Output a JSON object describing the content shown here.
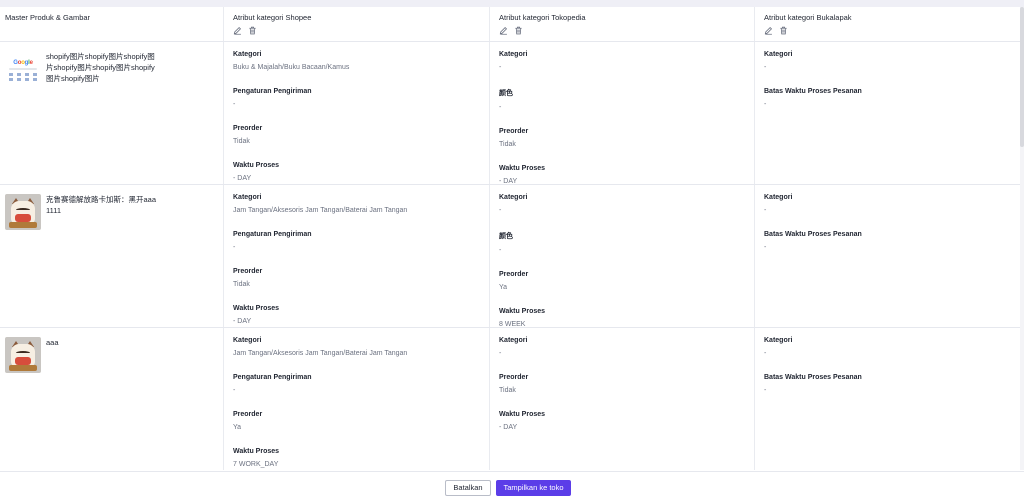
{
  "header": {
    "col0": "Master Produk & Gambar",
    "col1": "Atribut kategori Shopee",
    "col2": "Atribut kategori Tokopedia",
    "col3": "Atribut kategori Bukalapak"
  },
  "rows": [
    {
      "product": {
        "name": "shopify图片shopify图片shopify图片shopify图片shopify图片shopify图片shopify图片"
      },
      "shopee": [
        {
          "k": "Kategori",
          "v": "Buku & Majalah/Buku Bacaan/Kamus"
        },
        {
          "k": "Pengaturan Pengiriman",
          "v": "-"
        },
        {
          "k": "Preorder",
          "v": "Tidak"
        },
        {
          "k": "Waktu Proses",
          "v": "- DAY"
        }
      ],
      "tokopedia": [
        {
          "k": "Kategori",
          "v": "-"
        },
        {
          "k": "颜色",
          "v": "-"
        },
        {
          "k": "Preorder",
          "v": "Tidak"
        },
        {
          "k": "Waktu Proses",
          "v": "- DAY"
        }
      ],
      "bukalapak": [
        {
          "k": "Kategori",
          "v": "-"
        },
        {
          "k": "Batas Waktu Proses Pesanan",
          "v": "-"
        }
      ]
    },
    {
      "product": {
        "name": "克鲁赛德解放路卡加斯：黑开aaa1111"
      },
      "shopee": [
        {
          "k": "Kategori",
          "v": "Jam Tangan/Aksesoris Jam Tangan/Baterai Jam Tangan"
        },
        {
          "k": "Pengaturan Pengiriman",
          "v": "-"
        },
        {
          "k": "Preorder",
          "v": "Tidak"
        },
        {
          "k": "Waktu Proses",
          "v": "- DAY"
        }
      ],
      "tokopedia": [
        {
          "k": "Kategori",
          "v": "-"
        },
        {
          "k": "颜色",
          "v": "-"
        },
        {
          "k": "Preorder",
          "v": "Ya"
        },
        {
          "k": "Waktu Proses",
          "v": "8 WEEK"
        }
      ],
      "bukalapak": [
        {
          "k": "Kategori",
          "v": "-"
        },
        {
          "k": "Batas Waktu Proses Pesanan",
          "v": "-"
        }
      ]
    },
    {
      "product": {
        "name": "aaa"
      },
      "shopee": [
        {
          "k": "Kategori",
          "v": "Jam Tangan/Aksesoris Jam Tangan/Baterai Jam Tangan"
        },
        {
          "k": "Pengaturan Pengiriman",
          "v": "-"
        },
        {
          "k": "Preorder",
          "v": "Ya"
        },
        {
          "k": "Waktu Proses",
          "v": "7 WORK_DAY"
        }
      ],
      "tokopedia": [
        {
          "k": "Kategori",
          "v": "-"
        },
        {
          "k": "Preorder",
          "v": "Tidak"
        },
        {
          "k": "Waktu Proses",
          "v": "- DAY"
        }
      ],
      "bukalapak": [
        {
          "k": "Kategori",
          "v": "-"
        },
        {
          "k": "Batas Waktu Proses Pesanan",
          "v": "-"
        }
      ]
    }
  ],
  "thumb_logo": {
    "g1": "G",
    "g2": "o",
    "g3": "o",
    "g4": "g",
    "g5": "l",
    "g6": "e"
  },
  "footer": {
    "cancel_label": "Batalkan",
    "submit_label": "Tampilkan ke toko"
  },
  "icons": {
    "edit": "edit-icon",
    "delete": "trash-icon"
  },
  "colors": {
    "primary": "#5b3de8",
    "border": "#e6e8ee",
    "muted": "#6b7180"
  }
}
